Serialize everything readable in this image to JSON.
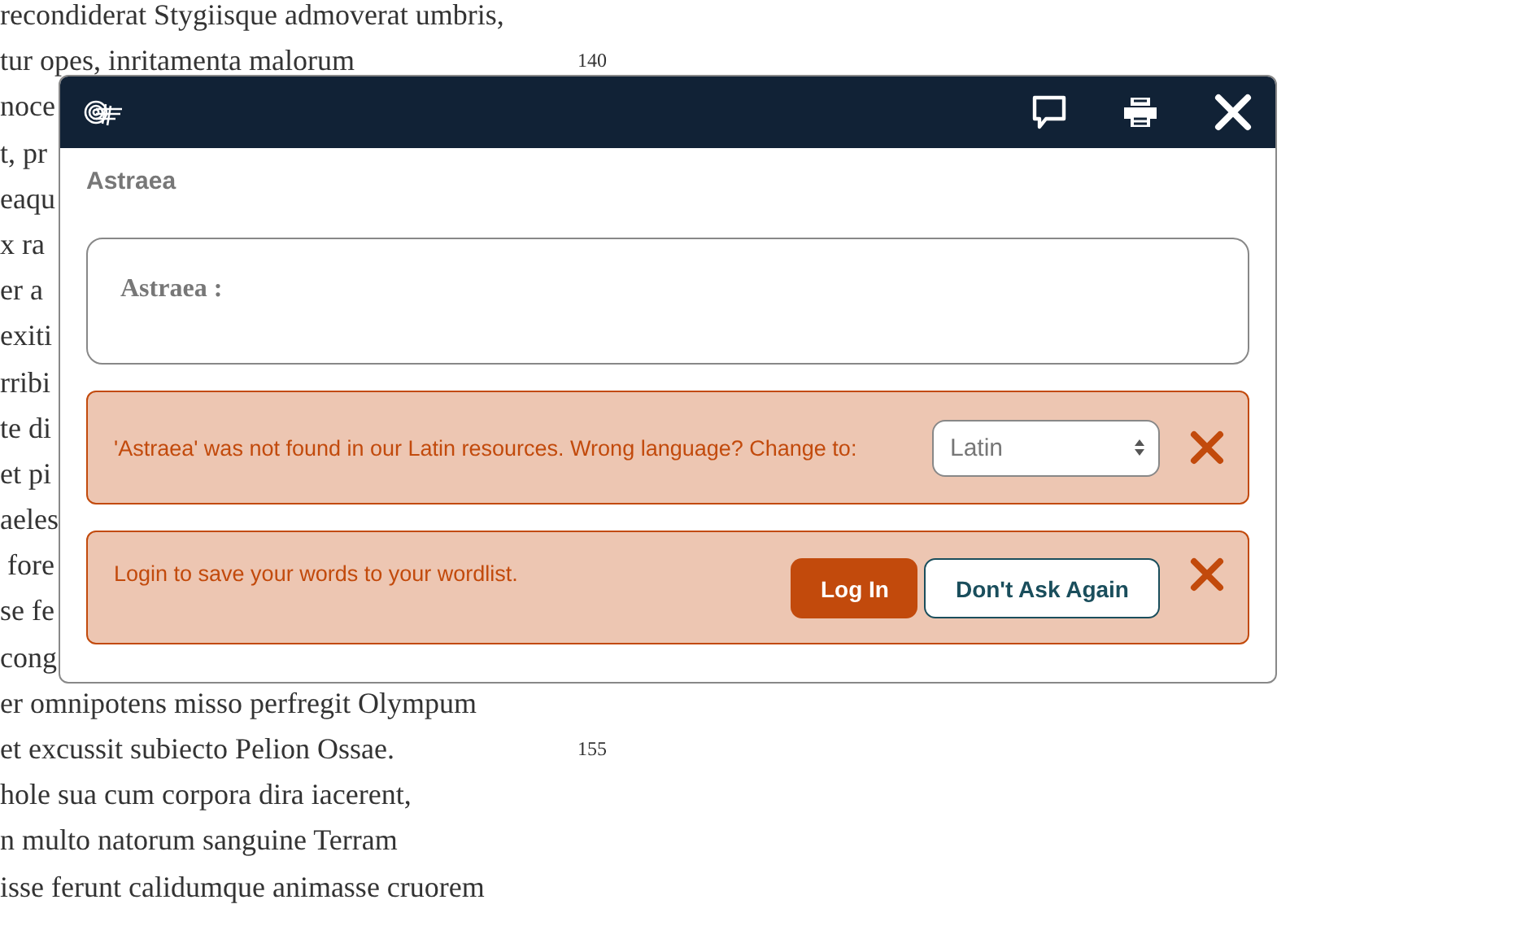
{
  "poem_lines": [
    {
      "text": "recondiderat Stygiisque admoverat umbris,"
    },
    {
      "text": "tur opes, inritamenta malorum",
      "line_number": "140"
    },
    {
      "text": "noce"
    },
    {
      "text": "t, pr"
    },
    {
      "text": "eaqu"
    },
    {
      "text": "x ra"
    },
    {
      "text": "er a"
    },
    {
      "text": "exiti"
    },
    {
      "text": "rribi"
    },
    {
      "text": "te di"
    },
    {
      "text": "et pi"
    },
    {
      "text": "aeles"
    },
    {
      "text": " fore"
    },
    {
      "text": "se fe"
    },
    {
      "text": "cong"
    },
    {
      "text": "er omnipotens misso perfregit Olympum"
    },
    {
      "text": "et excussit subiecto Pelion Ossae.",
      "line_number": "155"
    },
    {
      "text": "hole sua cum corpora dira iacerent,"
    },
    {
      "text": "n multo natorum sanguine Terram"
    },
    {
      "text": "isse ferunt calidumque animasse cruorem"
    }
  ],
  "dialog": {
    "title": "Astraea",
    "entry_label": "Astraea :",
    "alerts": [
      {
        "kind": "language",
        "message": "'Astraea' was not found in our Latin resources. Wrong language? Change to:",
        "select_value": "Latin"
      },
      {
        "kind": "login",
        "message": "Login to save your words to your wordlist.",
        "login_button": "Log In",
        "dismiss_button": "Don't Ask Again"
      }
    ]
  }
}
